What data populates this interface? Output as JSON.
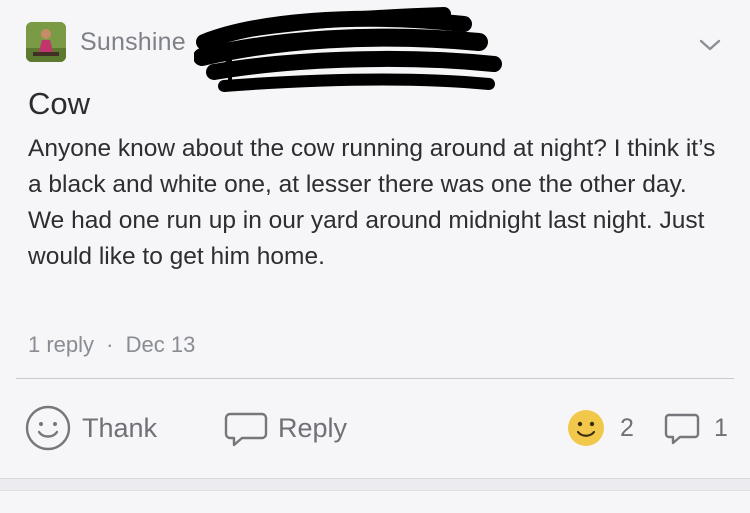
{
  "post": {
    "author_name": "Sunshine",
    "title": "Cow",
    "body": "Anyone know about the cow running around at night? I think it’s a black and white one, at lesser there was one the other day. We had one run up in our yard around midnight last night. Just would like to get him home.",
    "reply_count_text": "1 reply",
    "separator": "·",
    "date": "Dec 13"
  },
  "actions": {
    "thank_label": "Thank",
    "reply_label": "Reply"
  },
  "stats": {
    "reactions_count": "2",
    "replies_count": "1"
  },
  "icons": {
    "menu": "chevron-down-icon",
    "thank": "smile-outline-icon",
    "reply": "speech-bubble-icon",
    "reaction": "smiley-emoji-icon",
    "replies": "comment-icon"
  },
  "colors": {
    "background": "#f6f6f8",
    "text": "#2d2d32",
    "muted": "#8a8c93",
    "emoji": "#f2c84b"
  }
}
